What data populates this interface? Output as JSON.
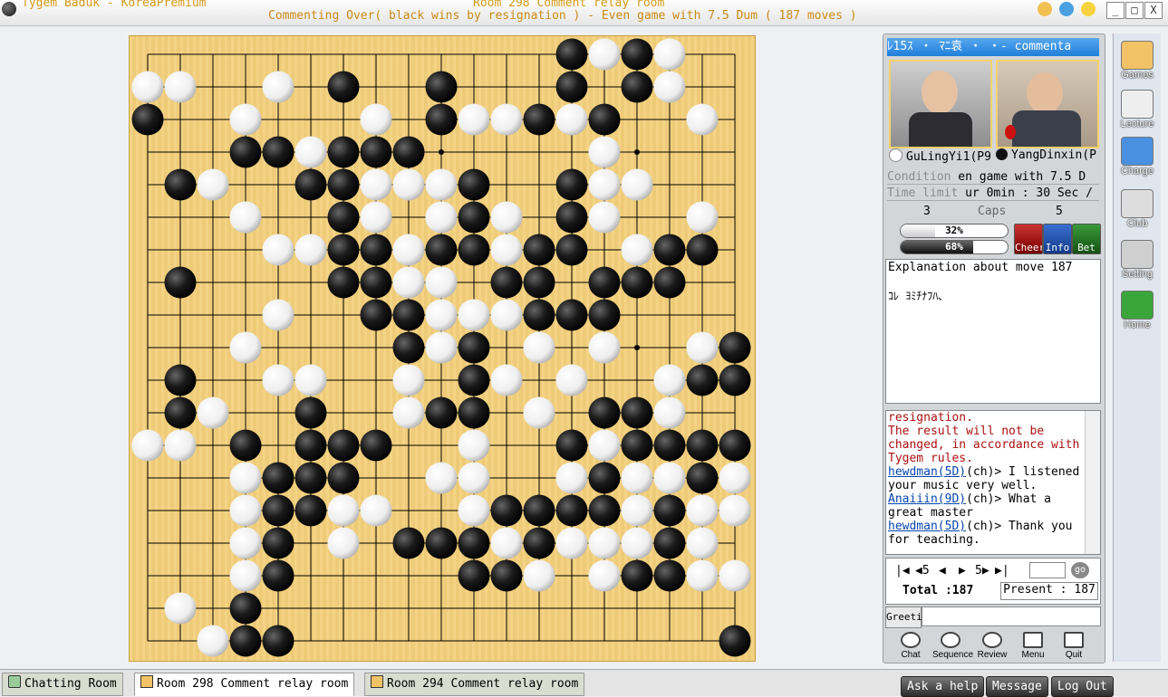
{
  "window": {
    "app_title": "Tygem Baduk - KoreaPremium",
    "room_title": "Room 298 Comment relay room",
    "subtitle": "Commenting Over( black wins by resignation ) - Even game with 7.5 Dum  ( 187 moves )",
    "controls": [
      "_",
      "□",
      "X"
    ]
  },
  "panel": {
    "room_strip": "ﾚ15ｽ ・ ﾏﾆ袁 ・ ・- commenta",
    "white_player": "GuLingYi1(P9",
    "black_player": "YangDinxin(P",
    "condition_label": "Condition",
    "condition_value": "en game with 7.5 D",
    "time_label": "Time limit",
    "time_value": "ur 0min : 30 Sec /",
    "caps_white": "3",
    "caps_label": "Caps",
    "caps_black": "5",
    "white_pct_label": "32%",
    "white_pct": 32,
    "black_pct_label": "68%",
    "black_pct": 68,
    "buttons": {
      "cheer": "Cheer",
      "info": "Info",
      "bet": "Bet"
    },
    "explain_title": "Explanation about move 187",
    "explain_body": "ｺﾚ ﾖﾐﾁﾅﾌﾊ､",
    "chat": [
      {
        "sys": "resignation."
      },
      {
        "sys": "The result will not be changed, in accordance with Tygem rules."
      },
      {
        "nick": "hewdman(5D)",
        "text": "(ch)> I listened your music very well."
      },
      {
        "nick": "Anaiiin(9D)",
        "text": "(ch)> What a great master"
      },
      {
        "nick": "hewdman(5D)",
        "text": "(ch)> Thank you for teaching."
      }
    ],
    "nav_symbols": [
      "|◀",
      "◀5",
      "◀",
      "▶",
      "5▶",
      "▶|"
    ],
    "nav_go": "go",
    "total_label": "Total :187",
    "present_label": "Present : 187",
    "greeting": "Greeting",
    "tools": [
      "Chat",
      "Sequence",
      "Review",
      "Menu",
      "Quit"
    ]
  },
  "sidebar": [
    "Games",
    "Lecture",
    "Charge",
    "Club",
    "Setting",
    "Home"
  ],
  "tabs": [
    "Chatting Room",
    "Room 298 Comment relay room",
    "Room 294 Comment relay room"
  ],
  "bottom_buttons": [
    "Ask a help",
    "Message",
    "Log Out"
  ],
  "board": {
    "size": 19,
    "last_move": "C5",
    "rows": [
      ".............XOXO..",
      "OO..O.X..X...X.XO..",
      "X..O...O.XOOXOX..O.",
      "...XXOXXX.....O....",
      ".XO..XXOOOX..XOO...",
      "...O..XO.OXO.XO..O.",
      "....OOXXOXXOXX.OXX.",
      ".X....XXOO.XX.XXX..",
      "....O..XXOOOXXX....",
      "...O....XOX.O.O..OX",
      ".X..OO..O.XO.O..OXX",
      ".XO..X..OXX.O.XXO..",
      "OO.X.XXX..O..XOXXXX",
      "...OXXX..OO..OXOOXO",
      "...OXXOO..OXXXXOXOO",
      "...OX.O.XXXOXOOOXO.",
      "...OX.....XXO.OXXOO",
      ".O.X...............",
      "..OXX.............X"
    ]
  }
}
